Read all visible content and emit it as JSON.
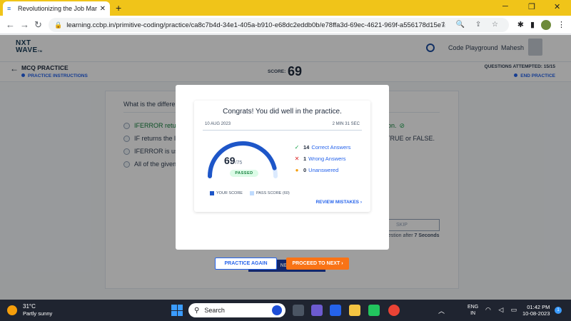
{
  "browser": {
    "tab_title": "Revolutionizing the Job Market | NxtWave",
    "url": "learning.ccbp.in/primitive-coding/practice/ca8c7b4d-34e1-405a-b910-e68dc2eddb0b/e78ffa3d-69ec-4621-969f-a556178d15e7"
  },
  "app": {
    "logo_line1": "NXT",
    "logo_line2": "WAVE",
    "logo_tm": "TM",
    "code_playground": "Code Playground",
    "user_name": "Mahesh"
  },
  "subheader": {
    "title": "MCQ PRACTICE",
    "instructions": "PRACTICE INSTRUCTIONS",
    "score_label": "SCORE:",
    "score_value": "69",
    "questions_attempted": "QUESTIONS ATTEMPTED: 15/15",
    "end_practice": "END PRACTICE"
  },
  "question": {
    "text": "What is the differe",
    "options": [
      {
        "left": "IFERROR retur",
        "right": "ion."
      },
      {
        "left": "IF returns the lo",
        "right": "TRUE or FALSE."
      },
      {
        "left": "IFERROR is use",
        "right": ""
      },
      {
        "left": "All of the given",
        "right": ""
      }
    ],
    "skip_label": "SKIP",
    "skip_hint_prefix": "uestion after",
    "skip_hint_seconds": "7 Seconds",
    "next_label": "NEXT"
  },
  "modal": {
    "congrats": "Congrats! You did well in the practice.",
    "date": "10 AUG 2023",
    "duration": "2 MIN 31 SEC",
    "score": "69",
    "out_of": "/75",
    "passed": "PASSED",
    "score_value": 69,
    "score_max": 75,
    "pass_score": 60,
    "correct_count": "14",
    "correct_label": "Correct Answers",
    "wrong_count": "1",
    "wrong_label": "Wrong Answers",
    "unanswered_count": "0",
    "unanswered_label": "Unanswered",
    "legend_your_score": "YOUR SCORE",
    "legend_pass_score": "PASS SCORE (60)",
    "review_mistakes": "REVIEW MISTAKES",
    "practice_again": "PRACTICE AGAIN",
    "proceed_next": "PROCEED TO NEXT",
    "colors": {
      "your_score": "#1e56c8",
      "pass_score": "#bfdbfe",
      "proceed": "#f97316"
    }
  },
  "taskbar": {
    "temperature": "31°C",
    "weather": "Partly sunny",
    "search_placeholder": "Search",
    "lang_line1": "ENG",
    "lang_line2": "IN",
    "time": "01:42 PM",
    "date": "10-08-2023",
    "notifications": "1"
  }
}
